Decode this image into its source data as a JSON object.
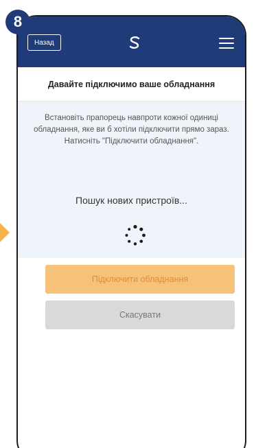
{
  "step": {
    "number": "8",
    "color": "#1f3c78"
  },
  "header": {
    "back_label": "Назад",
    "logo_icon": "s-logo-icon",
    "menu_icon": "hamburger-menu-icon",
    "background": "#1f3c78"
  },
  "page": {
    "title": "Давайте підключимо ваше обладнання"
  },
  "info": {
    "instructions": "Встановіть прапорець навпроти кожної одиниці обладнання, яке ви б хотіли підключити прямо зараз. Натисніть \"Підключити обладнання\".",
    "search_status": "Пошук нових пристроїв...",
    "spinner_icon": "loading-spinner-icon"
  },
  "actions": {
    "connect_label": "Підключити обладнання",
    "cancel_label": "Скасувати",
    "connect_color": "#f6c27a",
    "cancel_color": "#d9d9d9"
  },
  "accent": {
    "pointer_color": "#f3b24a"
  }
}
